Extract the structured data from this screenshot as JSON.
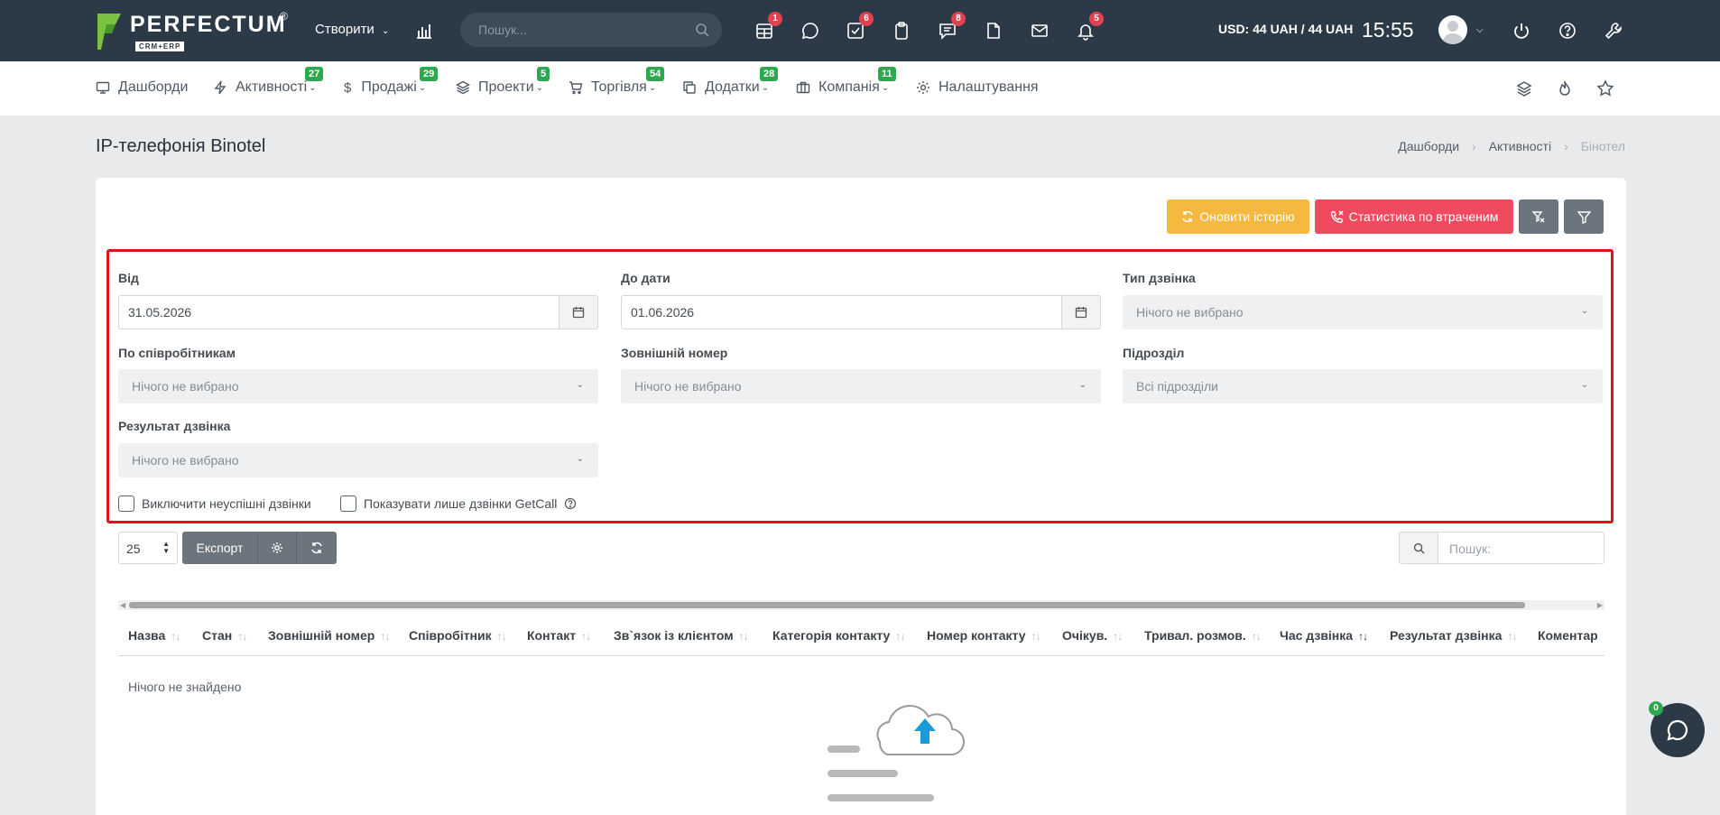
{
  "logo": {
    "name": "PERFECTUM",
    "sub": "CRM+ERP",
    "reg": "®"
  },
  "topbar": {
    "create_label": "Створити",
    "search_placeholder": "Пошук...",
    "badges": [
      "1",
      "6",
      "8",
      "5"
    ],
    "currency": "USD: 44 UAH / 44 UAH",
    "time": "15:55"
  },
  "nav": {
    "items": [
      {
        "label": "Дашборди",
        "badge": ""
      },
      {
        "label": "Активності",
        "badge": "27"
      },
      {
        "label": "Продажі",
        "badge": "29"
      },
      {
        "label": "Проекти",
        "badge": "5"
      },
      {
        "label": "Торгівля",
        "badge": "54"
      },
      {
        "label": "Додатки",
        "badge": "28"
      },
      {
        "label": "Компанія",
        "badge": "11"
      },
      {
        "label": "Налаштування",
        "badge": ""
      }
    ]
  },
  "page": {
    "title": "IP-телефонія Binotel",
    "breadcrumb": [
      "Дашборди",
      "Активності",
      "Бінотел"
    ]
  },
  "actions": {
    "refresh_history": "Оновити історію",
    "lost_stats": "Статистика по втраченим"
  },
  "filters": {
    "from_label": "Від",
    "from_value": "31.05.2026",
    "to_label": "До дати",
    "to_value": "01.06.2026",
    "call_type_label": "Тип дзвінка",
    "call_type_value": "Нічого не вибрано",
    "employees_label": "По співробітникам",
    "employees_value": "Нічого не вибрано",
    "external_label": "Зовнішній номер",
    "external_value": "Нічого не вибрано",
    "department_label": "Підрозділ",
    "department_value": "Всі підрозділи",
    "result_label": "Результат дзвінка",
    "result_value": "Нічого не вибрано",
    "exclude_failed": "Виключити неуспішні дзвінки",
    "getcall_only": "Показувати лише дзвінки GetCall"
  },
  "table": {
    "page_length": "25",
    "export_label": "Експорт",
    "search_placeholder": "Пошук:",
    "columns": [
      "Назва",
      "Стан",
      "Зовнішній номер",
      "Співробітник",
      "Контакт",
      "Зв`язок із клієнтом",
      "Категорія контакту",
      "Номер контакту",
      "Очікув.",
      "Тривал. розмов.",
      "Час дзвінка",
      "Результат дзвінка",
      "Коментар"
    ],
    "empty_text": "Нічого не знайдено"
  },
  "chat": {
    "badge": "0"
  },
  "colors": {
    "topbar": "#2c3a47",
    "warning": "#f5b940",
    "danger": "#ef4a5e",
    "success_badge": "#2ea84e",
    "highlight": "#e3101e"
  }
}
